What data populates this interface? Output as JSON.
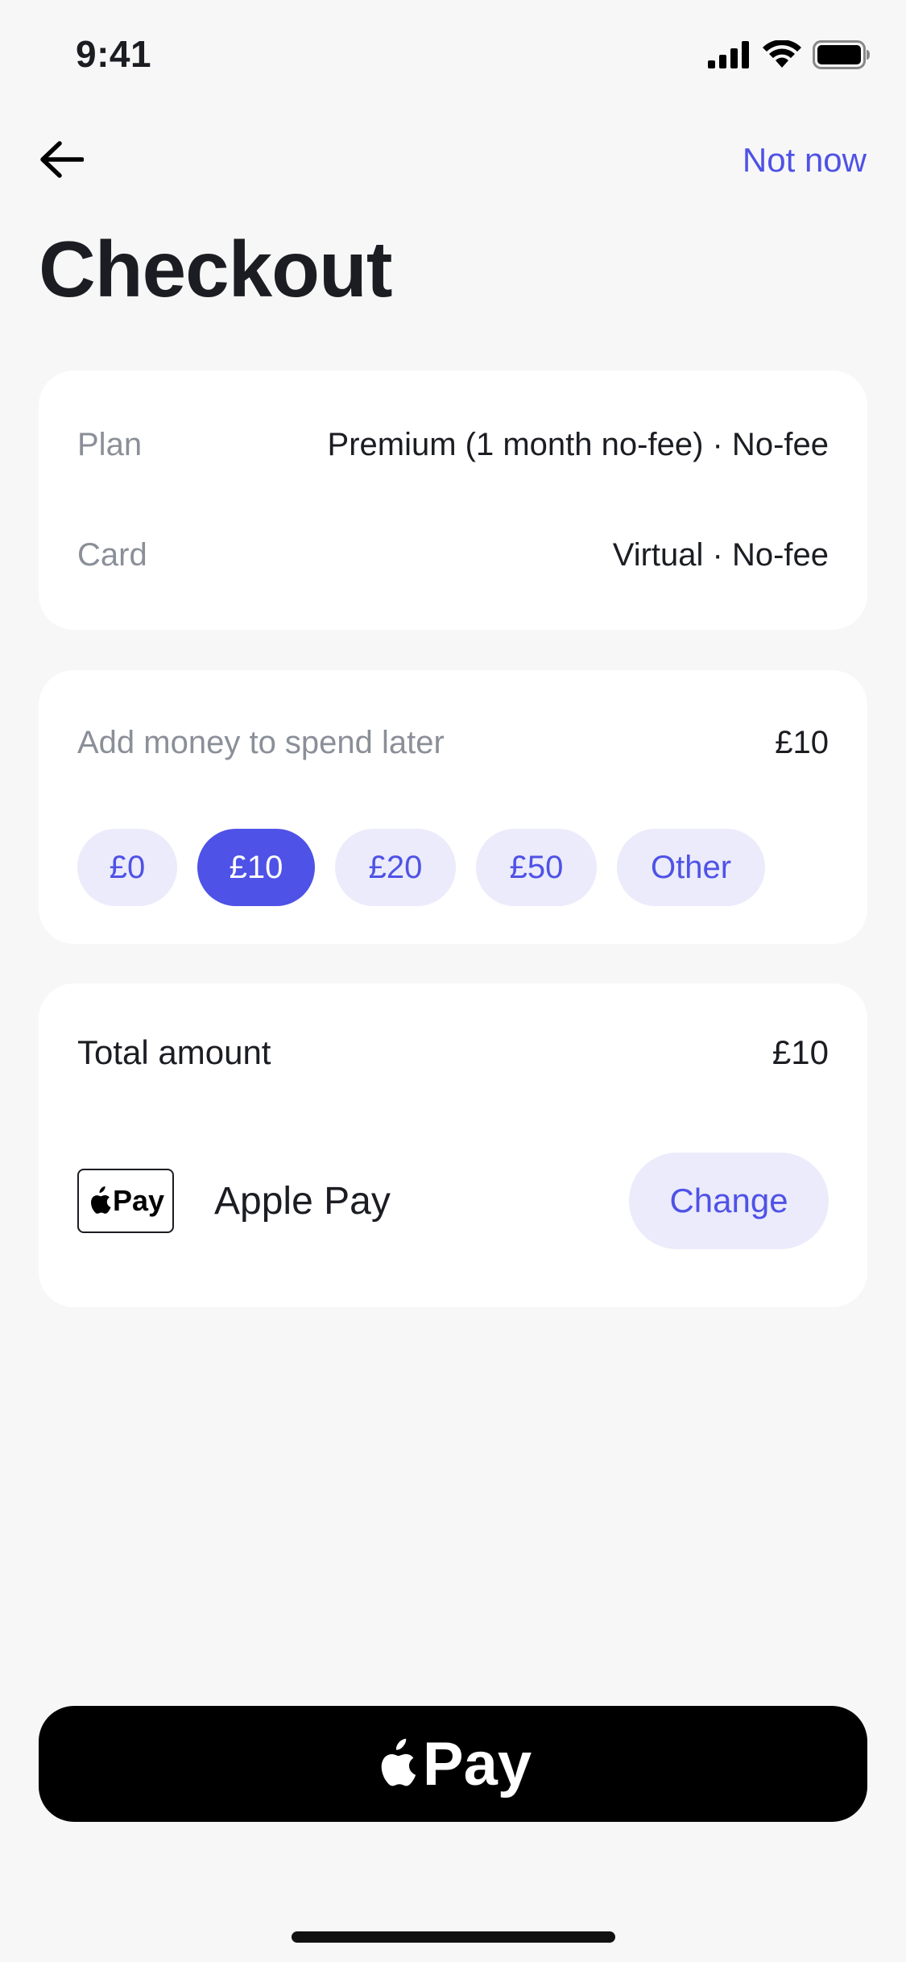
{
  "status_bar": {
    "time": "9:41"
  },
  "nav": {
    "not_now_label": "Not now"
  },
  "page": {
    "title": "Checkout"
  },
  "summary": {
    "plan_label": "Plan",
    "plan_value": "Premium (1 month no-fee) · No-fee",
    "card_label": "Card",
    "card_value": "Virtual · No-fee"
  },
  "add_money": {
    "label": "Add money to spend later",
    "value": "£10",
    "options": [
      "£0",
      "£10",
      "£20",
      "£50",
      "Other"
    ],
    "selected": "£10"
  },
  "total": {
    "label": "Total amount",
    "value": "£10"
  },
  "payment_method": {
    "badge_text": "Pay",
    "name": "Apple Pay",
    "change_label": "Change"
  },
  "cta": {
    "label": "Pay"
  },
  "icons": {
    "back": "arrow-left-icon",
    "signal": "cellular-signal-icon",
    "wifi": "wifi-icon",
    "battery": "battery-icon",
    "apple": "apple-logo-icon"
  },
  "colors": {
    "accent": "#4f52e6",
    "chip_bg": "#ebebfb",
    "background": "#f7f7f7",
    "card_bg": "#ffffff",
    "cta_bg": "#000000"
  }
}
